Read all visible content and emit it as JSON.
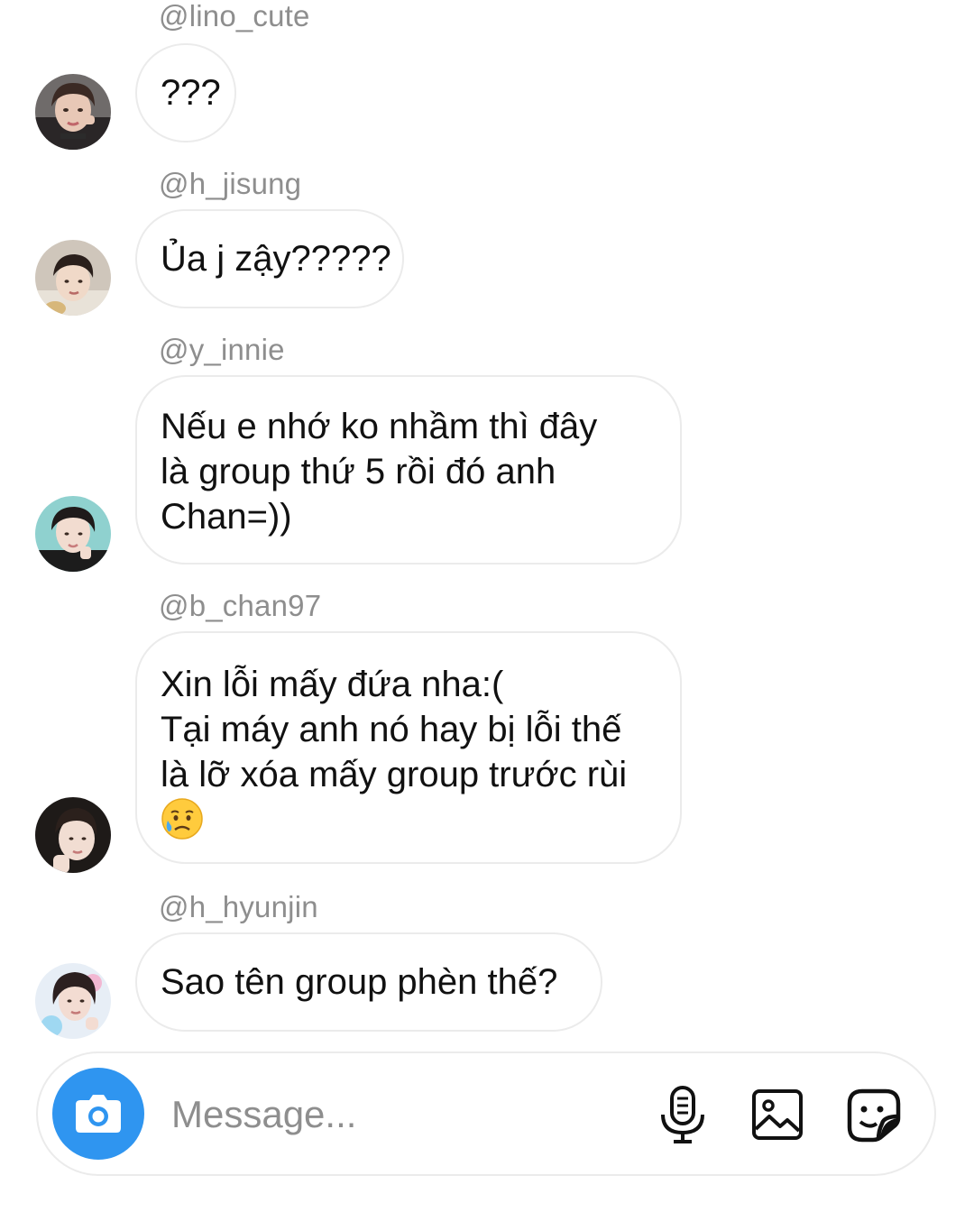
{
  "messages": [
    {
      "username": "@lino_cute",
      "lines": [
        "???"
      ],
      "avatar_icon": "user-avatar-photo"
    },
    {
      "username": "@h_jisung",
      "lines": [
        "Ủa j zậy?????"
      ],
      "avatar_icon": "user-avatar-photo"
    },
    {
      "username": "@y_innie",
      "lines": [
        "Nếu e nhớ ko nhầm thì đây",
        "là group thứ 5 rồi đó anh",
        "Chan=))"
      ],
      "avatar_icon": "user-avatar-photo"
    },
    {
      "username": "@b_chan97",
      "lines": [
        "Xin lỗi mấy đứa nha:(",
        "Tại máy anh nó hay bị lỗi thế",
        "là lỡ xóa mấy group trước rùi"
      ],
      "emoji": "sad-but-relieved-face",
      "avatar_icon": "user-avatar-photo"
    },
    {
      "username": "@h_hyunjin",
      "lines": [
        "Sao tên group phèn thế?"
      ],
      "avatar_icon": "user-avatar-photo"
    }
  ],
  "composer": {
    "placeholder": "Message...",
    "value": "",
    "camera_icon": "camera-icon",
    "mic_icon": "microphone-icon",
    "gallery_icon": "image-gallery-icon",
    "sticker_icon": "sticker-icon"
  },
  "colors": {
    "accent": "#2f95f0",
    "username": "#8e8e8e",
    "bubble_border": "#ebebeb",
    "text": "#111111"
  }
}
